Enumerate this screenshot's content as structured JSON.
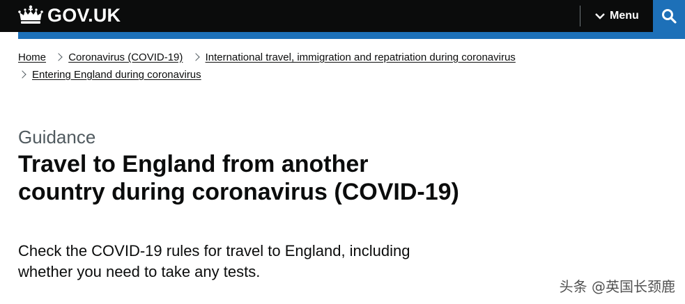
{
  "header": {
    "logo_text": "GOV.UK",
    "menu_label": "Menu",
    "search_icon": "search-icon",
    "brand_color": "#1d70b8",
    "bar_color": "#0b0c0c"
  },
  "breadcrumb": {
    "items": [
      {
        "label": "Home"
      },
      {
        "label": "Coronavirus (COVID-19)"
      },
      {
        "label": "International travel, immigration and repatriation during coronavirus"
      },
      {
        "label": "Entering England during coronavirus"
      }
    ]
  },
  "main": {
    "caption": "Guidance",
    "title_line1": "Travel to England from another",
    "title_line2": "country during coronavirus (COVID-19)",
    "lead_line1": "Check the COVID-19 rules for travel to England, including",
    "lead_line2": "whether you need to take any tests."
  },
  "watermark": "头条 @英国长颈鹿"
}
